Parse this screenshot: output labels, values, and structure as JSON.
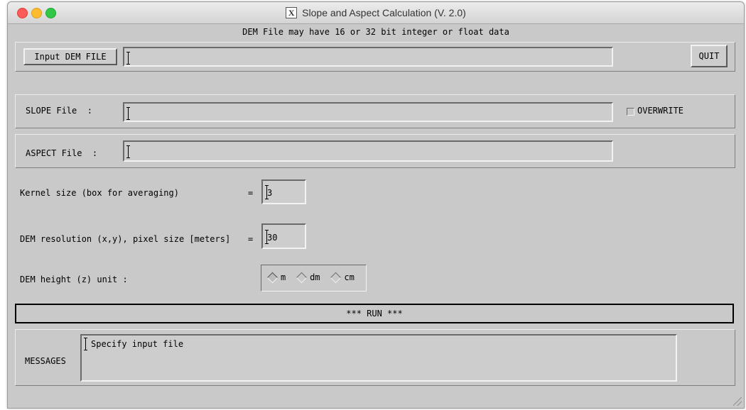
{
  "window": {
    "title": "Slope and Aspect Calculation (V. 2.0)"
  },
  "notice": "DEM File may have 16 or 32 bit integer or float data",
  "input_row": {
    "button_label": "Input DEM FILE",
    "value": "",
    "quit_label": "QUIT"
  },
  "slope_row": {
    "label": "SLOPE File  :",
    "value": "",
    "overwrite_label": "OVERWRITE",
    "overwrite_checked": false
  },
  "aspect_row": {
    "label": "ASPECT File  :",
    "value": ""
  },
  "kernel": {
    "label": "Kernel size (box for averaging)",
    "eq": "=",
    "value": "3"
  },
  "resolution": {
    "label": "DEM resolution (x,y), pixel size [meters]",
    "eq": "=",
    "value": "30"
  },
  "height_unit": {
    "label": "DEM height (z) unit :",
    "options": [
      "m",
      "dm",
      "cm"
    ],
    "selected": "m"
  },
  "run_label": "*** RUN ***",
  "messages": {
    "label": "MESSAGES",
    "text": "Specify input file"
  },
  "colors": {
    "window_bg": "#c9c9c9",
    "close": "#fc5b57",
    "minimize": "#fdbc2e",
    "zoom": "#33c748"
  },
  "icons": {
    "app": "x11-icon"
  }
}
